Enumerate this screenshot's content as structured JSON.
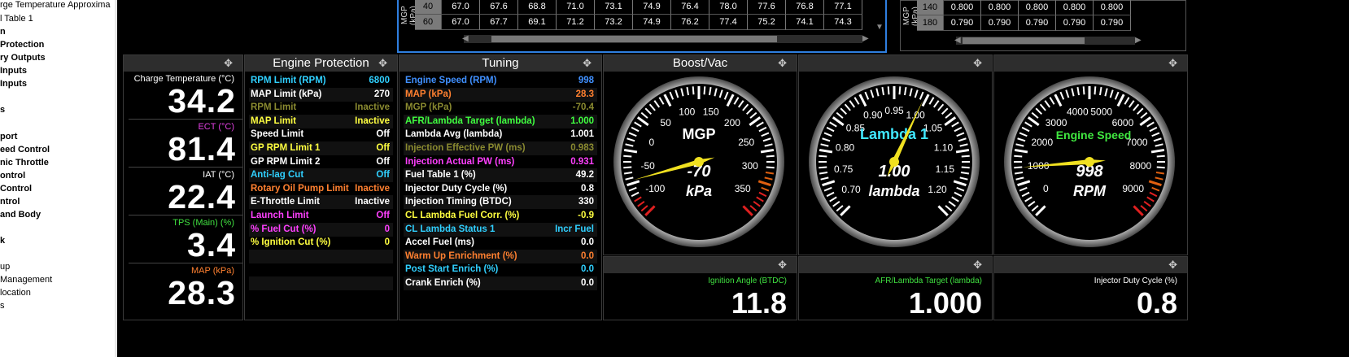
{
  "sidebar": {
    "items": [
      {
        "label": "rge Temperature Approxima",
        "bold": false
      },
      {
        "label": "l Table 1",
        "bold": false
      },
      {
        "label": "n",
        "bold": true
      },
      {
        "label": "Protection",
        "bold": true
      },
      {
        "label": "ry Outputs",
        "bold": true
      },
      {
        "label": "Inputs",
        "bold": true
      },
      {
        "label": "Inputs",
        "bold": true
      },
      {
        "label": "s",
        "bold": true
      },
      {
        "label": "port",
        "bold": true
      },
      {
        "label": "eed Control",
        "bold": true
      },
      {
        "label": "nic Throttle",
        "bold": true
      },
      {
        "label": "ontrol",
        "bold": true
      },
      {
        "label": "Control",
        "bold": true
      },
      {
        "label": "ntrol",
        "bold": true
      },
      {
        "label": "and Body",
        "bold": true
      },
      {
        "label": "k",
        "bold": true
      },
      {
        "label": "up",
        "bold": false
      },
      {
        "label": "Management",
        "bold": false
      },
      {
        "label": "location",
        "bold": false
      },
      {
        "label": "s",
        "bold": false
      }
    ]
  },
  "table1": {
    "axis_label": "MGP (kPa)",
    "rows": [
      {
        "header": "40",
        "cells": [
          "67.0",
          "67.6",
          "68.8",
          "71.0",
          "73.1",
          "74.9",
          "76.4",
          "78.0",
          "77.6",
          "76.8",
          "77.1"
        ]
      },
      {
        "header": "60",
        "cells": [
          "67.0",
          "67.7",
          "69.1",
          "71.2",
          "73.2",
          "74.9",
          "76.2",
          "77.4",
          "75.2",
          "74.1",
          "74.3"
        ]
      }
    ]
  },
  "table2": {
    "axis_label": "MGP (kPa)",
    "rows": [
      {
        "header": "140",
        "cells": [
          "0.800",
          "0.800",
          "0.800",
          "0.800",
          "0.800"
        ]
      },
      {
        "header": "180",
        "cells": [
          "0.790",
          "0.790",
          "0.790",
          "0.790",
          "0.790"
        ]
      }
    ]
  },
  "charge_panel": {
    "tiles": [
      {
        "label": "Charge Temperature (°C)",
        "value": "34.2",
        "color": "#ffffff"
      },
      {
        "label": "ECT (°C)",
        "value": "81.4",
        "color": "#e040e0"
      },
      {
        "label": "IAT (°C)",
        "value": "22.4",
        "color": "#ffffff"
      },
      {
        "label": "TPS (Main) (%)",
        "value": "3.4",
        "color": "#40e040"
      },
      {
        "label": "MAP (kPa)",
        "value": "28.3",
        "color": "#ff8030"
      }
    ]
  },
  "engine_protection": {
    "title": "Engine Protection",
    "rows": [
      {
        "label": "RPM Limit (RPM)",
        "value": "6800",
        "color": "#30d0ff"
      },
      {
        "label": "MAP Limit (kPa)",
        "value": "270",
        "color": "#ffffff"
      },
      {
        "label": "RPM Limit",
        "value": "Inactive",
        "color": "#8a8a30"
      },
      {
        "label": "MAP Limit",
        "value": "Inactive",
        "color": "#ffff40"
      },
      {
        "label": "Speed Limit",
        "value": "Off",
        "color": "#ffffff"
      },
      {
        "label": "GP RPM Limit 1",
        "value": "Off",
        "color": "#ffff40"
      },
      {
        "label": "GP RPM Limit 2",
        "value": "Off",
        "color": "#ffffff"
      },
      {
        "label": "Anti-lag Cut",
        "value": "Off",
        "color": "#30d0ff"
      },
      {
        "label": "Rotary Oil Pump Limit",
        "value": "Inactive",
        "color": "#ff8030"
      },
      {
        "label": "E-Throttle Limit",
        "value": "Inactive",
        "color": "#ffffff"
      },
      {
        "label": "Launch Limit",
        "value": "Off",
        "color": "#ff40ff"
      },
      {
        "label": "% Fuel Cut (%)",
        "value": "0",
        "color": "#ff40ff"
      },
      {
        "label": "% Ignition Cut (%)",
        "value": "0",
        "color": "#ffff40"
      }
    ]
  },
  "tuning": {
    "title": "Tuning",
    "rows": [
      {
        "label": "Engine Speed (RPM)",
        "value": "998",
        "color": "#4090ff"
      },
      {
        "label": "MAP (kPa)",
        "value": "28.3",
        "color": "#ff8030"
      },
      {
        "label": "MGP (kPa)",
        "value": "-70.4",
        "color": "#8a8a30"
      },
      {
        "label": "AFR/Lambda Target (lambda)",
        "value": "1.000",
        "color": "#40ff40"
      },
      {
        "label": "Lambda Avg (lambda)",
        "value": "1.001",
        "color": "#ffffff"
      },
      {
        "label": "Injection Effective PW (ms)",
        "value": "0.983",
        "color": "#8a8a30"
      },
      {
        "label": "Injection Actual PW (ms)",
        "value": "0.931",
        "color": "#ff40ff"
      },
      {
        "label": "Fuel Table 1 (%)",
        "value": "49.2",
        "color": "#ffffff"
      },
      {
        "label": "Injector Duty Cycle (%)",
        "value": "0.8",
        "color": "#ffffff"
      },
      {
        "label": "Injection Timing (BTDC)",
        "value": "330",
        "color": "#ffffff"
      },
      {
        "label": "CL Lambda Fuel Corr. (%)",
        "value": "-0.9",
        "color": "#ffff40"
      },
      {
        "label": "CL Lambda Status 1",
        "value": "Incr Fuel",
        "color": "#30d0ff"
      },
      {
        "label": "Accel Fuel (ms)",
        "value": "0.0",
        "color": "#ffffff"
      },
      {
        "label": "Warm Up Enrichment (%)",
        "value": "0.0",
        "color": "#ff8030"
      },
      {
        "label": "Post Start Enrich (%)",
        "value": "0.0",
        "color": "#30d0ff"
      },
      {
        "label": "Crank Enrich (%)",
        "value": "0.0",
        "color": "#ffffff"
      }
    ]
  },
  "gauges": [
    {
      "title": "Boost/Vac",
      "name": "MGP",
      "value": "-70",
      "unit": "kPa",
      "name_color": "#ffffff",
      "ticks": [
        "-100",
        "-50",
        "0",
        "50",
        "100",
        "150",
        "200",
        "250",
        "300",
        "350"
      ],
      "min": -125,
      "max": 375,
      "current": -70.4
    },
    {
      "title": "",
      "name": "Lambda 1",
      "value": "1.00",
      "unit": "lambda",
      "name_color": "#40e8ff",
      "ticks": [
        "0.70",
        "0.75",
        "0.80",
        "0.85",
        "0.90",
        "0.95",
        "1.00",
        "1.05",
        "1.10",
        "1.15",
        "1.20"
      ],
      "min": 0.675,
      "max": 1.225,
      "current": 1.001
    },
    {
      "title": "",
      "name": "Engine Speed",
      "value": "998",
      "unit": "RPM",
      "name_color": "#40e840",
      "ticks": [
        "0",
        "1000",
        "2000",
        "3000",
        "4000",
        "5000",
        "6000",
        "7000",
        "8000",
        "9000"
      ],
      "min": -500,
      "max": 9500,
      "current": 998
    }
  ],
  "numeric_tiles": [
    {
      "label": "Ignition Angle (BTDC)",
      "value": "11.8",
      "label_color": "#40e040"
    },
    {
      "label": "AFR/Lambda Target (lambda)",
      "value": "1.000",
      "label_color": "#40e040"
    },
    {
      "label": "Injector Duty Cycle (%)",
      "value": "0.8",
      "label_color": "#ffffff"
    }
  ],
  "icons": {
    "expand": "expand-icon"
  }
}
